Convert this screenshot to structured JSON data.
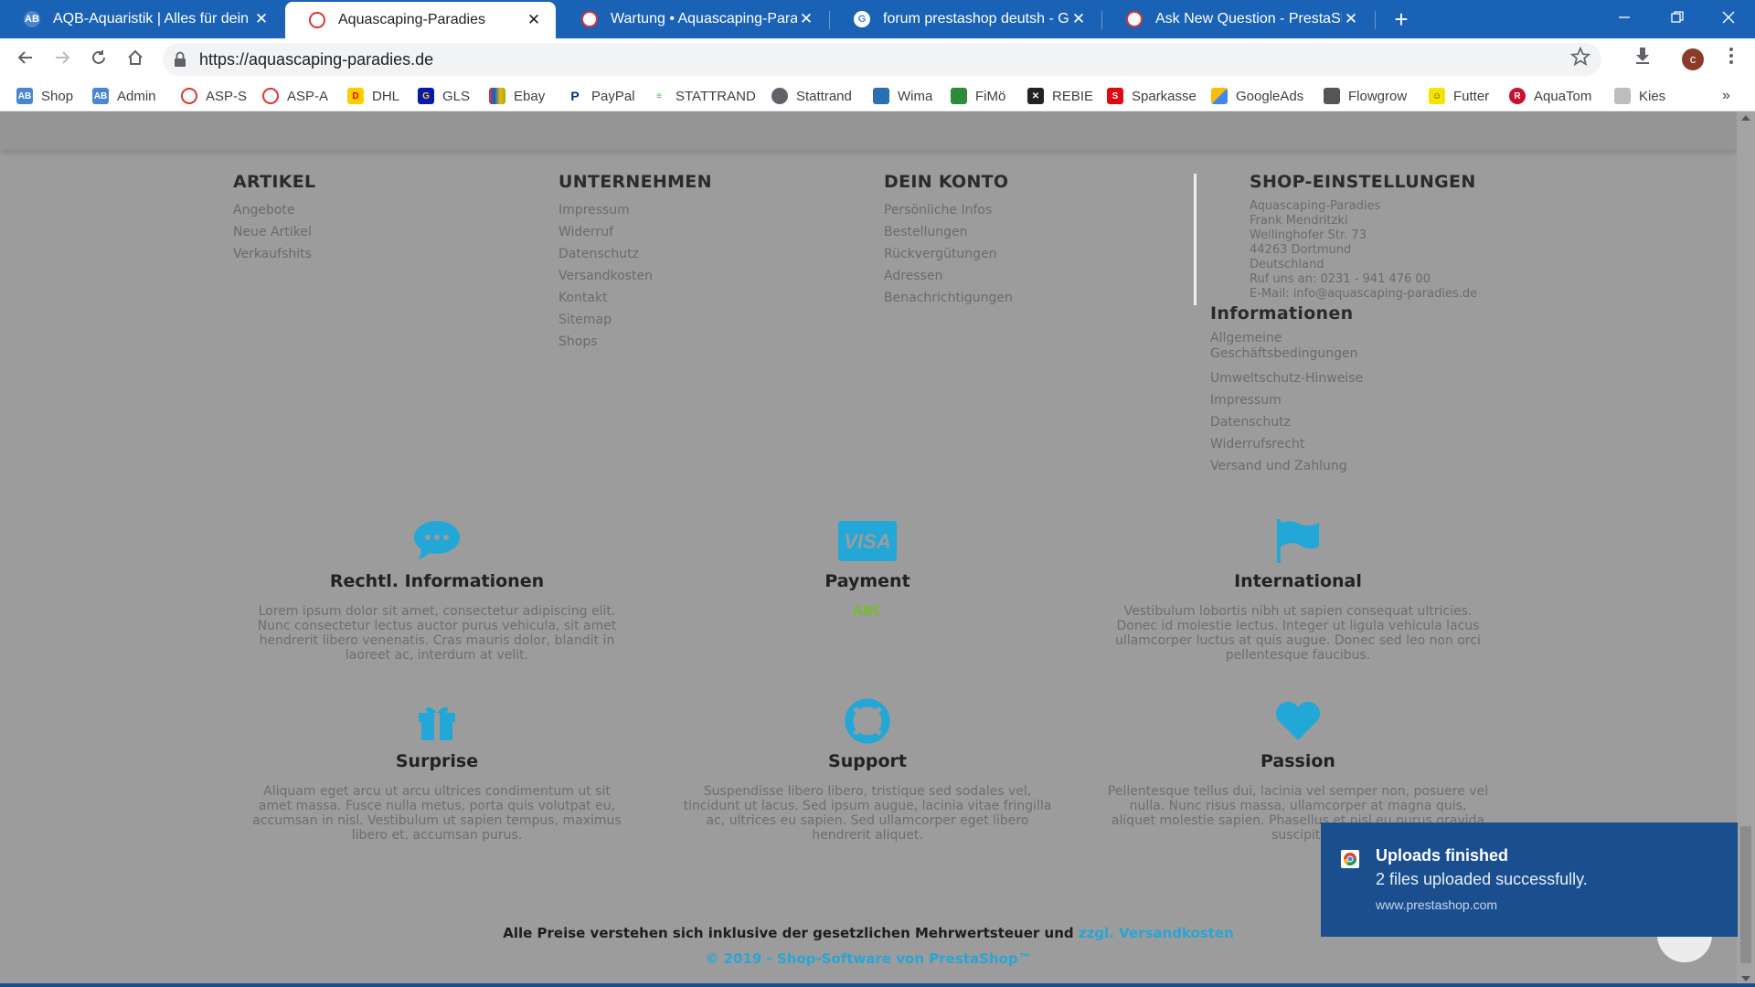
{
  "browser": {
    "tabs": [
      {
        "title": "AQB-Aquaristik | Alles für dein Aq",
        "active": false
      },
      {
        "title": "Aquascaping-Paradies",
        "active": true
      },
      {
        "title": "Wartung • Aquascaping-Paradies",
        "active": false
      },
      {
        "title": "forum prestashop deutsh - Googl",
        "active": false
      },
      {
        "title": "Ask New Question - PrestaSh",
        "active": false
      }
    ],
    "tab_close_glyph": "✕",
    "new_tab_glyph": "+",
    "url": "https://aquascaping-paradies.de",
    "profile_initial": "c",
    "bookmarks": [
      {
        "label": "Shop",
        "icon": "aqb-icon"
      },
      {
        "label": "Admin",
        "icon": "aqb-icon"
      },
      {
        "label": "ASP-S",
        "icon": "prestashop-icon"
      },
      {
        "label": "ASP-A",
        "icon": "prestashop-icon"
      },
      {
        "label": "DHL",
        "icon": "dhl-icon"
      },
      {
        "label": "GLS",
        "icon": "gls-icon"
      },
      {
        "label": "Ebay",
        "icon": "ebay-icon"
      },
      {
        "label": "PayPal",
        "icon": "paypal-icon"
      },
      {
        "label": "STATTRAND",
        "icon": "stattrand-icon"
      },
      {
        "label": "Stattrand",
        "icon": "globe-icon"
      },
      {
        "label": "Wima",
        "icon": "wima-icon"
      },
      {
        "label": "FiMö",
        "icon": "fimo-icon"
      },
      {
        "label": "REBIE",
        "icon": "rebie-icon"
      },
      {
        "label": "Sparkasse",
        "icon": "sparkasse-icon"
      },
      {
        "label": "GoogleAds",
        "icon": "googleads-icon"
      },
      {
        "label": "Flowgrow",
        "icon": "flowgrow-icon"
      },
      {
        "label": "Futter",
        "icon": "futter-icon"
      },
      {
        "label": "AquaTom",
        "icon": "aquatom-icon"
      },
      {
        "label": "Kies",
        "icon": "kies-icon"
      }
    ],
    "bookmarks_more": "»"
  },
  "footer": {
    "artikel": {
      "heading": "ARTIKEL",
      "links": [
        "Angebote",
        "Neue Artikel",
        "Verkaufshits"
      ]
    },
    "unternehmen": {
      "heading": "UNTERNEHMEN",
      "links": [
        "Impressum",
        "Widerruf",
        "Datenschutz",
        "Versandkosten",
        "Kontakt",
        "Sitemap",
        "Shops"
      ]
    },
    "konto": {
      "heading": "DEIN KONTO",
      "links": [
        "Persönliche Infos",
        "Bestellungen",
        "Rückvergütungen",
        "Adressen",
        "Benachrichtigungen"
      ]
    },
    "shop": {
      "heading": "SHOP-EINSTELLUNGEN",
      "address": [
        "Aquascaping-Paradies",
        "Frank Mendritzki",
        "Wellinghofer Str. 73",
        "44263 Dortmund",
        "Deutschland",
        "Ruf uns an: 0231 - 941 476 00",
        "E-Mail: info@aquascaping-paradies.de"
      ]
    },
    "informationen": {
      "heading": "Informationen",
      "links": [
        "Allgemeine Geschäftsbedingungen",
        "Umweltschutz-Hinweise",
        "Impressum",
        "Datenschutz",
        "Widerrufsrecht",
        "Versand und Zahlung"
      ]
    }
  },
  "info_blocks": [
    {
      "icon": "chat-bubble-icon",
      "title": "Rechtl. Informationen",
      "text": "Lorem ipsum dolor sit amet, consectetur adipiscing elit. Nunc consectetur lectus auctor purus vehicula, sit amet hendrerit libero venenatis. Cras mauris dolor, blandit in laoreet ac, interdum at velit."
    },
    {
      "icon": "visa-card-icon",
      "title": "Payment",
      "text": "",
      "sub": "ABC"
    },
    {
      "icon": "flag-icon",
      "title": "International",
      "text": "Vestibulum lobortis nibh ut sapien consequat ultricies. Donec id molestie lectus. Integer ut ligula vehicula lacus ullamcorper luctus at quis augue. Donec sed leo non orci pellentesque faucibus."
    },
    {
      "icon": "gift-icon",
      "title": "Surprise",
      "text": "Aliquam eget arcu ut arcu ultrices condimentum ut sit amet massa. Fusce nulla metus, porta quis volutpat eu, accumsan in nisl. Vestibulum ut sapien tempus, maximus libero et, accumsan purus."
    },
    {
      "icon": "lifebuoy-icon",
      "title": "Support",
      "text": "Suspendisse libero libero, tristique sed sodales vel, tincidunt ut lacus. Sed ipsum augue, lacinia vitae fringilla ac, ultrices eu sapien. Sed ullamcorper eget libero hendrerit aliquet."
    },
    {
      "icon": "heart-icon",
      "title": "Passion",
      "text": "Pellentesque tellus dui, lacinia vel semper non, posuere vel nulla. Nunc risus massa, ullamcorper at magna quis, aliquet molestie sapien. Phasellus et nisl eu purus gravida suscipit."
    }
  ],
  "footer_bottom": {
    "prices_text": "Alle Preise verstehen sich inklusive der gesetzlichen Mehrwertsteuer und ",
    "shipping_link": "zzgl. Versandkosten",
    "copyright": "© 2019 - Shop-Software von PrestaShop™"
  },
  "notification": {
    "title": "Uploads finished",
    "body": "2 files uploaded successfully.",
    "source": "www.prestashop.com"
  },
  "colors": {
    "accent": "#2aa5d4",
    "titlebar": "#1a62b6",
    "toast": "#1a4e8f"
  }
}
